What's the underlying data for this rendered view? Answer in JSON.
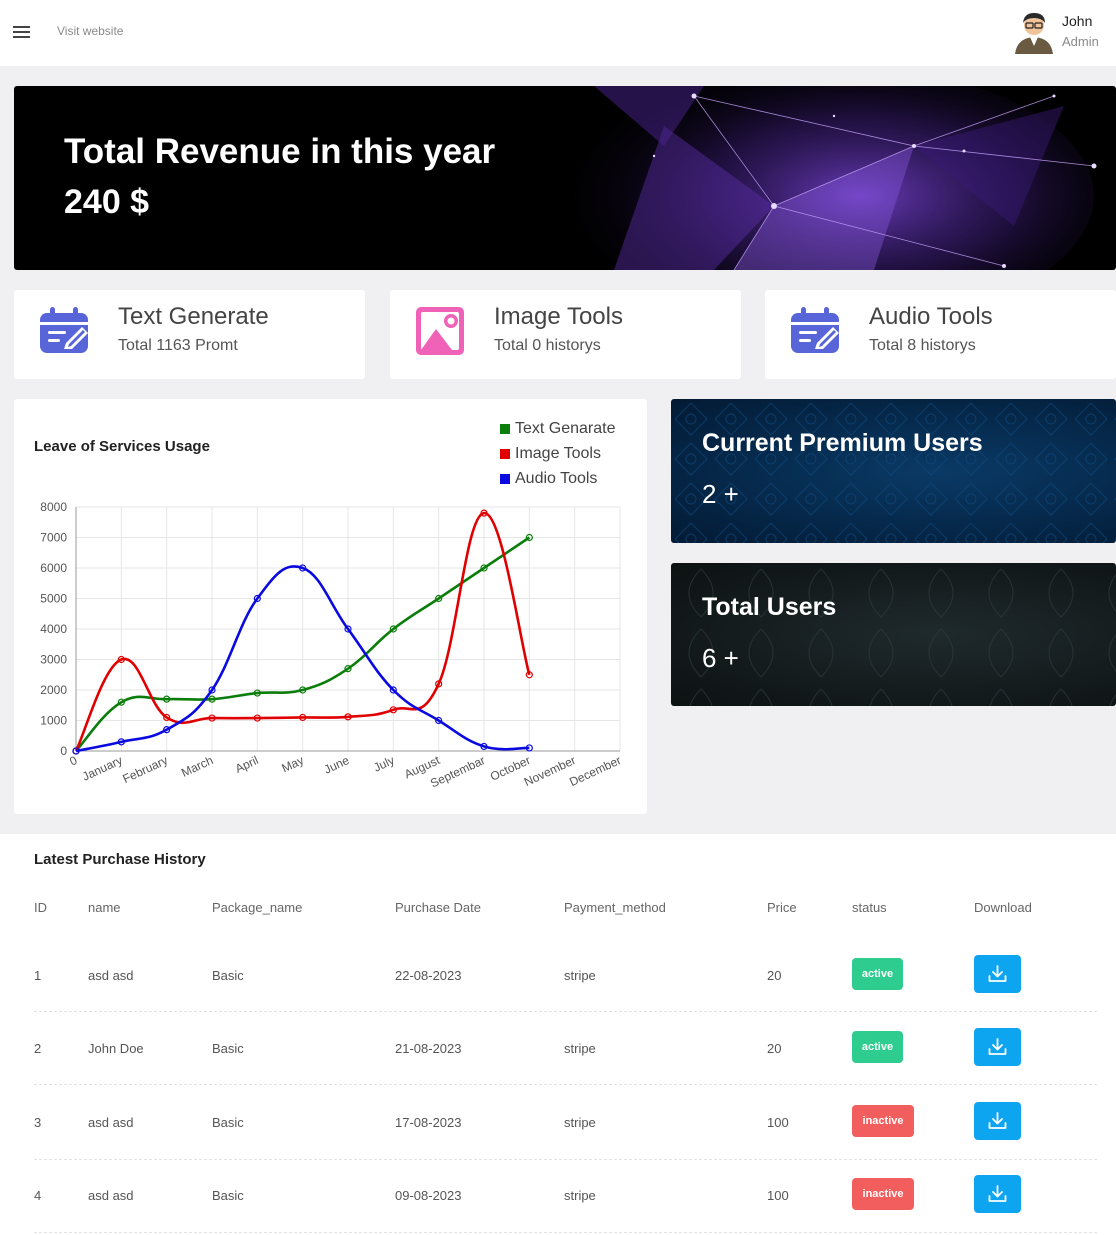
{
  "topbar": {
    "visit_label": "Visit website",
    "user_name": "John",
    "user_role": "Admin"
  },
  "hero": {
    "title": "Total Revenue in this year",
    "value": "240 $"
  },
  "tools": [
    {
      "title": "Text Generate",
      "subtitle": "Total 1163 Promt",
      "icon": "calendar-edit-icon",
      "color": "#5865d8"
    },
    {
      "title": "Image Tools",
      "subtitle": "Total 0 historys",
      "icon": "image-icon",
      "color": "#f062b8"
    },
    {
      "title": "Audio Tools",
      "subtitle": "Total 8 historys",
      "icon": "calendar-edit-icon",
      "color": "#5865d8"
    }
  ],
  "chart_data": {
    "type": "line",
    "title": "Leave of Services Usage",
    "categories": [
      "January",
      "February",
      "March",
      "April",
      "May",
      "June",
      "July",
      "August",
      "Septembar",
      "October",
      "November",
      "December"
    ],
    "x_origin_label": "0",
    "ylim": [
      0,
      8000
    ],
    "yticks": [
      0,
      1000,
      2000,
      3000,
      4000,
      5000,
      6000,
      7000,
      8000
    ],
    "grid": true,
    "legend_position": "top-right",
    "series": [
      {
        "name": "Text Genarate",
        "color": "#0a7d0a",
        "values": [
          0,
          1600,
          1700,
          1700,
          1900,
          2000,
          2700,
          4000,
          5000,
          6000,
          7000
        ]
      },
      {
        "name": "Image Tools",
        "color": "#e00000",
        "values": [
          0,
          3000,
          1100,
          1080,
          1080,
          1100,
          1120,
          1350,
          2200,
          7800,
          2500
        ]
      },
      {
        "name": "Audio Tools",
        "color": "#0a0ae0",
        "values": [
          0,
          300,
          700,
          2000,
          5000,
          6000,
          4000,
          2000,
          1000,
          150,
          100
        ]
      }
    ]
  },
  "stats": {
    "premium_title": "Current Premium Users",
    "premium_value": "2 +",
    "total_title": "Total Users",
    "total_value": "6 +"
  },
  "history": {
    "title": "Latest Purchase History",
    "headers": [
      "ID",
      "name",
      "Package_name",
      "Purchase Date",
      "Payment_method",
      "Price",
      "status",
      "Download"
    ],
    "rows": [
      {
        "id": "1",
        "name": "asd asd",
        "package": "Basic",
        "date": "22-08-2023",
        "method": "stripe",
        "price": "20",
        "status": "active"
      },
      {
        "id": "2",
        "name": "John Doe",
        "package": "Basic",
        "date": "21-08-2023",
        "method": "stripe",
        "price": "20",
        "status": "active"
      },
      {
        "id": "3",
        "name": "asd asd",
        "package": "Basic",
        "date": "17-08-2023",
        "method": "stripe",
        "price": "100",
        "status": "inactive"
      },
      {
        "id": "4",
        "name": "asd asd",
        "package": "Basic",
        "date": "09-08-2023",
        "method": "stripe",
        "price": "100",
        "status": "inactive"
      }
    ]
  }
}
